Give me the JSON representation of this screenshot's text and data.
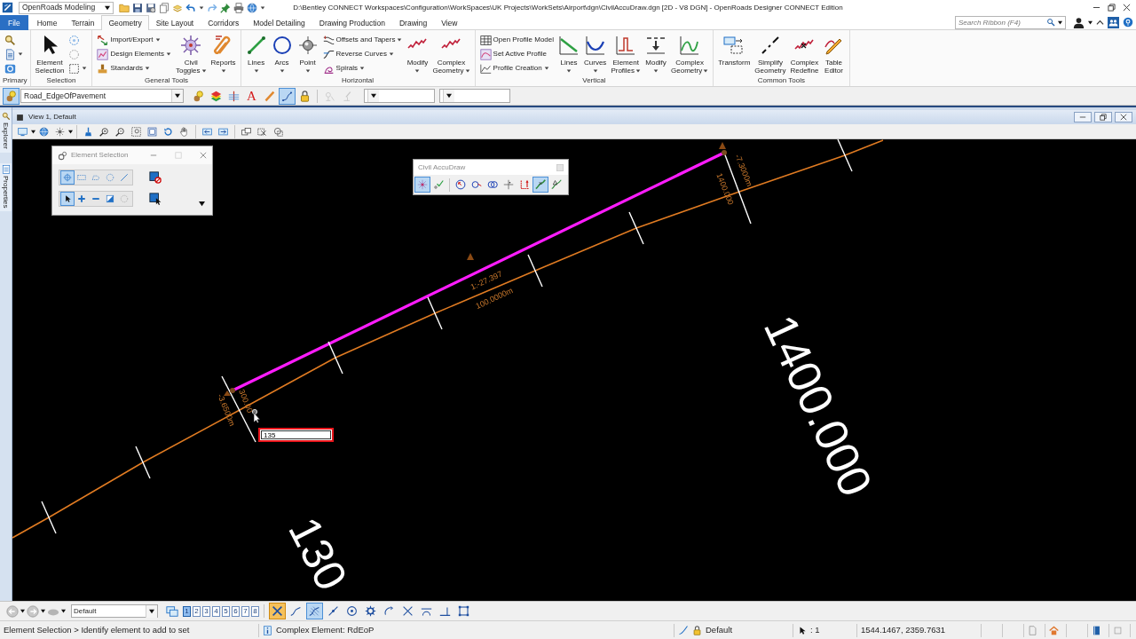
{
  "title_bar": {
    "workflow": "OpenRoads Modeling",
    "title": "D:\\Bentley CONNECT Workspaces\\Configuration\\WorkSpaces\\UK Projects\\WorkSets\\Airport\\dgn\\CivilAccuDraw.dgn [2D - V8 DGN] - OpenRoads Designer CONNECT Edition"
  },
  "ribbon_tabs": [
    {
      "label": "File",
      "kind": "backstage",
      "selected": false
    },
    {
      "label": "Home",
      "kind": "tab",
      "selected": false
    },
    {
      "label": "Terrain",
      "kind": "tab",
      "selected": false
    },
    {
      "label": "Geometry",
      "kind": "tab",
      "selected": true
    },
    {
      "label": "Site Layout",
      "kind": "tab",
      "selected": false
    },
    {
      "label": "Corridors",
      "kind": "tab",
      "selected": false
    },
    {
      "label": "Model Detailing",
      "kind": "tab",
      "selected": false
    },
    {
      "label": "Drawing Production",
      "kind": "tab",
      "selected": false
    },
    {
      "label": "Drawing",
      "kind": "tab",
      "selected": false
    },
    {
      "label": "View",
      "kind": "tab",
      "selected": false
    }
  ],
  "search": {
    "placeholder": "Search Ribbon (F4)"
  },
  "ribbon_groups": [
    {
      "label": "Primary",
      "buttons": [
        {
          "kind": "icon",
          "dropdown": false
        },
        {
          "kind": "icon",
          "dropdown": true
        },
        {
          "kind": "icon",
          "dropdown": false
        }
      ]
    },
    {
      "label": "Selection",
      "buttons": [
        {
          "kind": "large",
          "label": "Element Selection",
          "dropdown": false
        },
        {
          "kind": "icon",
          "dropdown": false
        },
        {
          "kind": "icon",
          "dropdown": false
        },
        {
          "kind": "icon",
          "dropdown": true
        }
      ]
    },
    {
      "label": "General Tools",
      "buttons": [
        {
          "kind": "small",
          "label": "Import/Export",
          "dropdown": true
        },
        {
          "kind": "small",
          "label": "Design Elements",
          "dropdown": true
        },
        {
          "kind": "small",
          "label": "Standards",
          "dropdown": true
        },
        {
          "kind": "large",
          "label": "Civil Toggles",
          "dropdown": true
        },
        {
          "kind": "large",
          "label": "Reports",
          "dropdown": true
        }
      ]
    },
    {
      "label": "Horizontal",
      "buttons": [
        {
          "kind": "large",
          "label": "Lines",
          "dropdown": true
        },
        {
          "kind": "large",
          "label": "Arcs",
          "dropdown": true
        },
        {
          "kind": "large",
          "label": "Point",
          "dropdown": true
        },
        {
          "kind": "small",
          "label": "Offsets and Tapers",
          "dropdown": true
        },
        {
          "kind": "small",
          "label": "Reverse Curves",
          "dropdown": true
        },
        {
          "kind": "small",
          "label": "Spirals",
          "dropdown": true
        },
        {
          "kind": "large",
          "label": "Modify",
          "dropdown": true
        },
        {
          "kind": "large",
          "label": "Complex Geometry",
          "dropdown": true
        }
      ]
    },
    {
      "label": "Vertical",
      "buttons": [
        {
          "kind": "small",
          "label": "Open Profile Model",
          "dropdown": false
        },
        {
          "kind": "small",
          "label": "Set Active Profile",
          "dropdown": false
        },
        {
          "kind": "small",
          "label": "Profile Creation",
          "dropdown": true
        },
        {
          "kind": "large",
          "label": "Lines",
          "dropdown": true
        },
        {
          "kind": "large",
          "label": "Curves",
          "dropdown": true
        },
        {
          "kind": "large",
          "label": "Element Profiles",
          "dropdown": true
        },
        {
          "kind": "large",
          "label": "Modify",
          "dropdown": true
        },
        {
          "kind": "large",
          "label": "Complex Geometry",
          "dropdown": true
        }
      ]
    },
    {
      "label": "Common Tools",
      "buttons": [
        {
          "kind": "large",
          "label": "Transform",
          "dropdown": false
        },
        {
          "kind": "large",
          "label": "Simplify Geometry",
          "dropdown": false
        },
        {
          "kind": "large",
          "label": "Complex Redefine",
          "dropdown": false
        },
        {
          "kind": "large",
          "label": "Table Editor",
          "dropdown": false
        }
      ]
    }
  ],
  "attribute_toolbar": {
    "feature_toggle": {
      "on": true
    },
    "feature_definition": "Road_EdgeOfPavement",
    "tools": [
      {
        "kind": "icon",
        "on": false,
        "disabled": false
      },
      {
        "kind": "icon",
        "on": false,
        "disabled": false
      },
      {
        "kind": "icon",
        "on": false,
        "disabled": false
      },
      {
        "kind": "glyph",
        "glyph": "A",
        "on": false,
        "disabled": false
      },
      {
        "kind": "icon",
        "on": false,
        "disabled": false
      },
      {
        "kind": "icon",
        "on": true,
        "disabled": false
      },
      {
        "kind": "icon",
        "on": false,
        "disabled": false
      },
      {
        "kind": "icon",
        "on": false,
        "disabled": true
      },
      {
        "kind": "icon",
        "on": false,
        "disabled": true
      }
    ]
  },
  "side_tabs": [
    {
      "label": "Explorer"
    },
    {
      "label": "Properties"
    }
  ],
  "view": {
    "title": "View 1, Default"
  },
  "drawing": {
    "annotations": [
      {
        "text": "-7.3000m"
      },
      {
        "text": "1400.000"
      },
      {
        "text": "1:-27.397"
      },
      {
        "text": "100.0000m"
      },
      {
        "text": "300.00"
      },
      {
        "text": "-3.6500m"
      }
    ],
    "stations": [
      {
        "text": "1400.000"
      },
      {
        "text": "130"
      }
    ]
  },
  "element_selection": {
    "title": "Element Selection",
    "methods": [
      {
        "selected": true
      },
      {
        "selected": false
      },
      {
        "selected": false
      },
      {
        "selected": false
      },
      {
        "selected": false
      }
    ],
    "modes": [
      {
        "selected": true
      },
      {
        "selected": false
      },
      {
        "selected": false
      },
      {
        "selected": false
      },
      {
        "selected": false
      }
    ]
  },
  "accudraw": {
    "title": "Civil AccuDraw",
    "tools": [
      {
        "on": true
      },
      {
        "on": false
      },
      {
        "on": false
      },
      {
        "on": false
      },
      {
        "on": false
      },
      {
        "on": false
      },
      {
        "on": false
      },
      {
        "on": true
      },
      {
        "on": false
      }
    ]
  },
  "distance_input": {
    "value": "135"
  },
  "view_bar": {
    "view_group": "Default",
    "views": [
      {
        "label": "1",
        "selected": true
      },
      {
        "label": "2",
        "selected": false
      },
      {
        "label": "3",
        "selected": false
      },
      {
        "label": "4",
        "selected": false
      },
      {
        "label": "5",
        "selected": false
      },
      {
        "label": "6",
        "selected": false
      },
      {
        "label": "7",
        "selected": false
      },
      {
        "label": "8",
        "selected": false
      }
    ],
    "accusnap": {
      "on": true
    },
    "snaps": [
      {
        "on": false
      },
      {
        "on": true
      },
      {
        "on": false
      },
      {
        "on": false
      },
      {
        "on": false
      },
      {
        "on": false
      },
      {
        "on": false
      },
      {
        "on": false
      },
      {
        "on": false
      },
      {
        "on": false
      }
    ]
  },
  "status_bar": {
    "prompt": "Element Selection > Identify element to add to set",
    "message": "Complex Element: RdEoP",
    "active_level": "Default",
    "selection_count": ": 1",
    "coordinates": "1544.1467, 2359.7631"
  }
}
